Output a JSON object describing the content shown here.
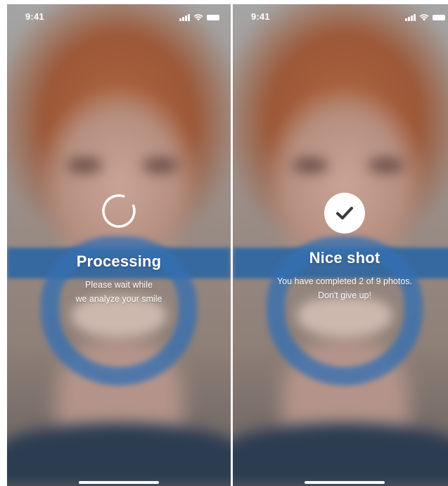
{
  "screens": [
    {
      "status_time": "9:41",
      "state_icon": "spinner-icon",
      "headline": "Processing",
      "message_lines": [
        "Please wait while",
        "we analyze your smile"
      ]
    },
    {
      "status_time": "9:41",
      "state_icon": "checkmark-icon",
      "headline": "Nice shot",
      "message_lines": [
        "You have completed 2 of 9 photos.",
        "Don't give up!"
      ],
      "progress": {
        "completed": 2,
        "total": 9
      }
    }
  ],
  "colors": {
    "overlay_text": "#ffffff",
    "retractor_blue": "#2664a4",
    "check_mark": "#3a3a3a"
  }
}
